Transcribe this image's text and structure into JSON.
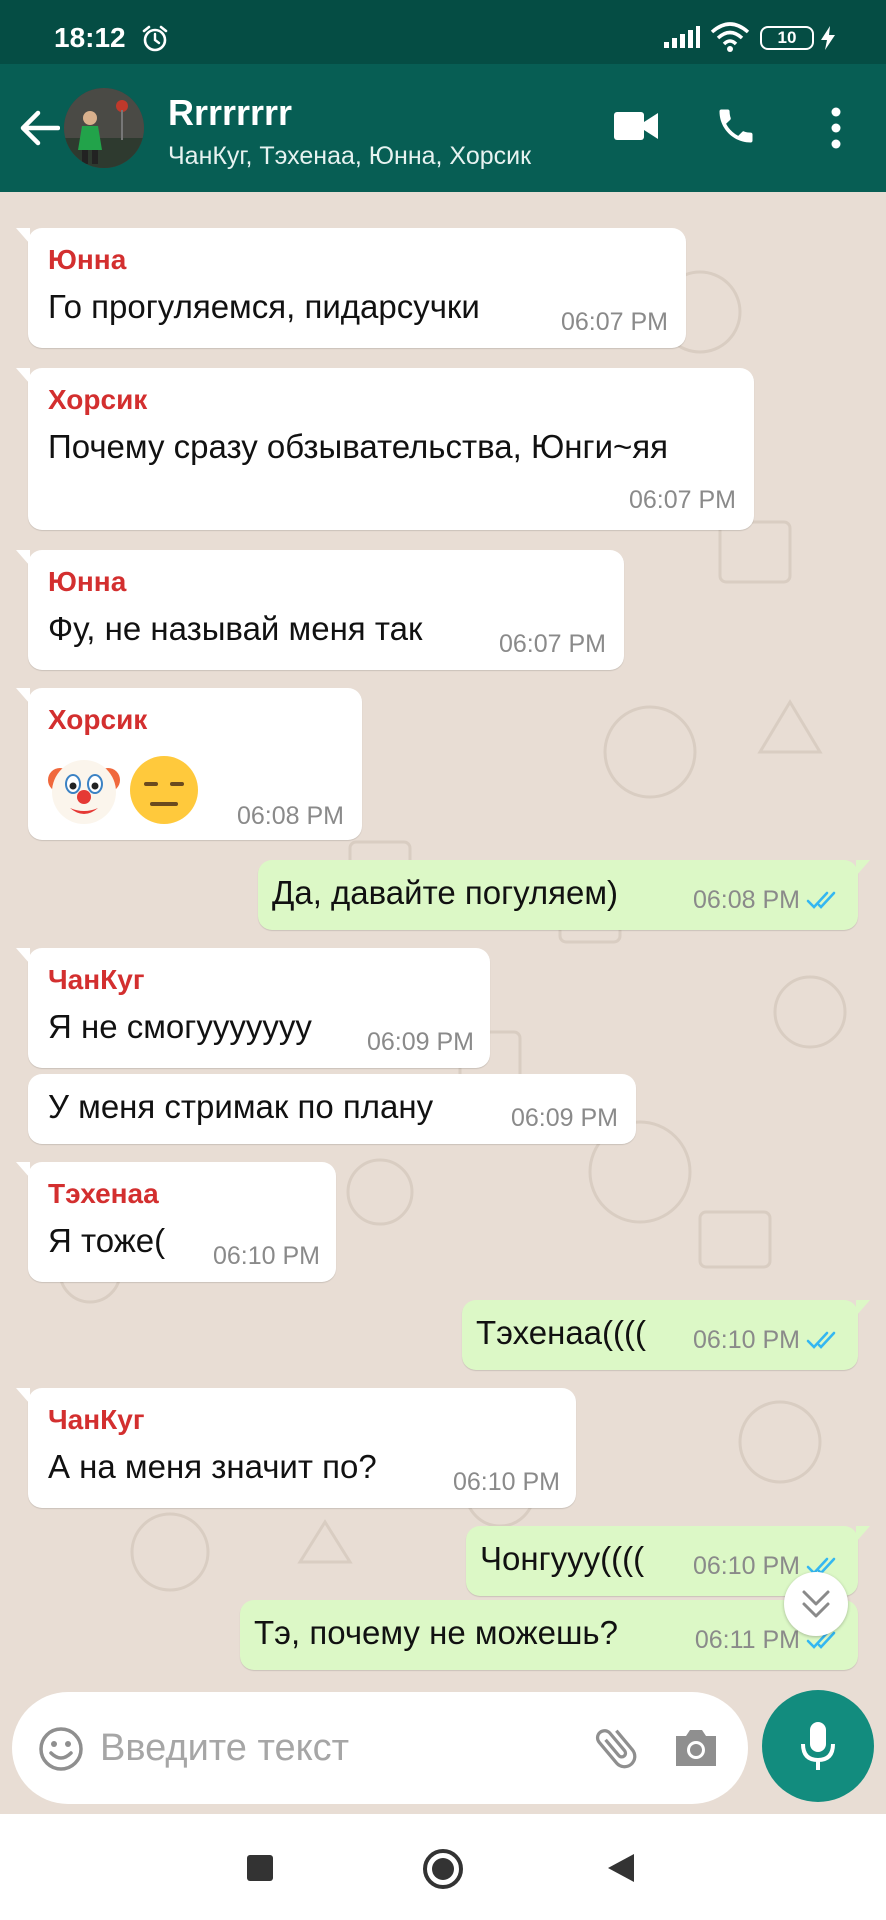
{
  "status_bar": {
    "time": "18:12",
    "battery": "10",
    "icons": [
      "alarm-icon",
      "signal-icon",
      "wifi-icon",
      "battery-icon",
      "charging-icon"
    ]
  },
  "header": {
    "title": "Rrrrrrrr",
    "members": "ЧанКуг, Тэхенаа, Юнна, Хорсик",
    "icons": [
      "back-arrow-icon",
      "video-call-icon",
      "voice-call-icon",
      "more-menu-icon"
    ]
  },
  "colors": {
    "header": "#075e54",
    "status_bar": "#054d44",
    "outgoing_bubble": "#dcf8c6",
    "incoming_bubble": "#ffffff",
    "sender_name": "#d32f2f",
    "read_ticks": "#34b7f1",
    "mic_button": "#128c7e"
  },
  "messages": [
    {
      "direction": "in",
      "sender": "Юнна",
      "text": "Го прогуляемся, пидарсучки",
      "time": "06:07 PM"
    },
    {
      "direction": "in",
      "sender": "Хорсик",
      "text": "Почему сразу обзывательства, Юнги~яя",
      "time": "06:07 PM"
    },
    {
      "direction": "in",
      "sender": "Юнна",
      "text": "Фу, не называй меня так",
      "time": "06:07 PM"
    },
    {
      "direction": "in",
      "sender": "Хорсик",
      "text": "",
      "emojis": [
        "clown-face-emoji",
        "expressionless-face-emoji"
      ],
      "time": "06:08 PM"
    },
    {
      "direction": "out",
      "text": "Да, давайте погуляем)",
      "time": "06:08 PM",
      "status": "read"
    },
    {
      "direction": "in",
      "sender": "ЧанКуг",
      "text": "Я не смогууууууу",
      "time": "06:09 PM"
    },
    {
      "direction": "in",
      "sender": "",
      "text": "У меня стримак по плану",
      "time": "06:09 PM"
    },
    {
      "direction": "in",
      "sender": "Тэхенаа",
      "text": "Я тоже(",
      "time": "06:10 PM"
    },
    {
      "direction": "out",
      "text": "Тэхенаа((((",
      "time": "06:10 PM",
      "status": "read"
    },
    {
      "direction": "in",
      "sender": "ЧанКуг",
      "text": "А на меня значит по?",
      "time": "06:10 PM"
    },
    {
      "direction": "out",
      "text": "Чонгууу((((",
      "time": "06:10 PM",
      "status": "read"
    },
    {
      "direction": "out",
      "text": "Тэ, почему не можешь?",
      "time": "06:11 PM",
      "status": "read"
    }
  ],
  "composer": {
    "placeholder": "Введите текст",
    "icons": [
      "emoji-icon",
      "attach-icon",
      "camera-icon",
      "mic-icon"
    ]
  },
  "scroll_button": {
    "icon": "double-chevron-down-icon"
  },
  "navigation": {
    "icons": [
      "recent-apps-icon",
      "home-icon",
      "back-icon"
    ]
  }
}
